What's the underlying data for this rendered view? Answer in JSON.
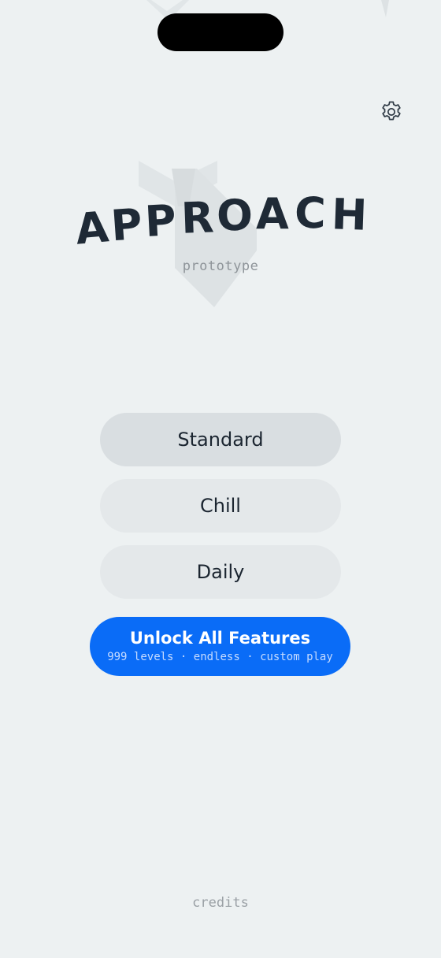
{
  "title": {
    "letters": [
      "A",
      "P",
      "P",
      "R",
      "O",
      "A",
      "C",
      "H"
    ]
  },
  "subtitle": "prototype",
  "modes": [
    {
      "label": "Standard",
      "selected": true
    },
    {
      "label": "Chill",
      "selected": false
    },
    {
      "label": "Daily",
      "selected": false
    }
  ],
  "unlock": {
    "title": "Unlock All Features",
    "subtitle": "999 levels · endless · custom play"
  },
  "credits": "credits",
  "icons": {
    "settings": "gear-icon"
  },
  "colors": {
    "background": "#edf1f2",
    "accent": "#0a6cf7",
    "text": "#1f2a36"
  }
}
